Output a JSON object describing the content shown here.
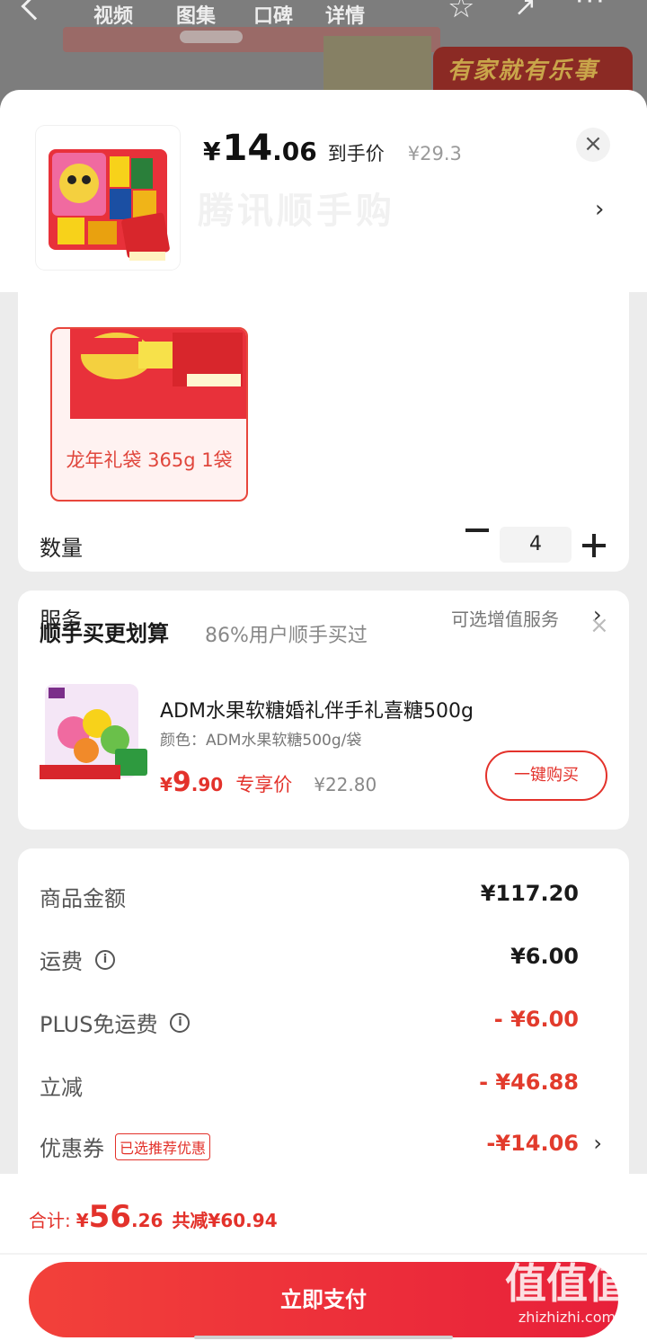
{
  "background": {
    "tabs": [
      "视频",
      "图集",
      "口碑",
      "详情"
    ],
    "ad_text": "有家就有乐事"
  },
  "header": {
    "yen": "¥",
    "price_int": "14",
    "price_dec": ".06",
    "price_tag": "到手价",
    "original_price": "¥29.3",
    "close": "×",
    "chevron": "›"
  },
  "spec": {
    "variant_label": "龙年礼袋 365g 1袋",
    "quantity_label": "数量",
    "quantity_value": "4",
    "service_label": "服务",
    "service_value": "可选增值服务",
    "service_chevron": "›"
  },
  "addon": {
    "title": "顺手买更划算",
    "subtitle": "86%用户顺手买过",
    "close": "×",
    "name": "ADM水果软糖婚礼伴手礼喜糖500g",
    "spec": "颜色：ADM水果软糖500g/袋",
    "yen": "¥",
    "price_int": "9",
    "price_dec": ".90",
    "price_tag": "专享价",
    "original_price": "¥22.80",
    "buy_label": "一键购买"
  },
  "summary": {
    "rows": [
      {
        "label": "商品金额",
        "value": "¥117.20"
      },
      {
        "label": "运费",
        "value": "¥6.00"
      },
      {
        "label": "PLUS免运费",
        "value": "- ¥6.00"
      },
      {
        "label": "立减",
        "value": "- ¥46.88"
      },
      {
        "label": "优惠券",
        "value": "-¥14.06",
        "tag": "已选推荐优惠"
      }
    ],
    "info_icon": "i",
    "coupon_chevron": "›"
  },
  "footer": {
    "total_label": "合计:",
    "yen": "¥",
    "total_int": "56",
    "total_dec": ".26",
    "saved": "共减¥60.94",
    "pay_label": "立即支付"
  },
  "watermark": {
    "big": "值值值",
    "small": "zhizhizhi.com"
  },
  "colors": {
    "accent": "#e3322b",
    "pay_gradient_start": "#f2413a",
    "pay_gradient_end": "#e8203a"
  }
}
